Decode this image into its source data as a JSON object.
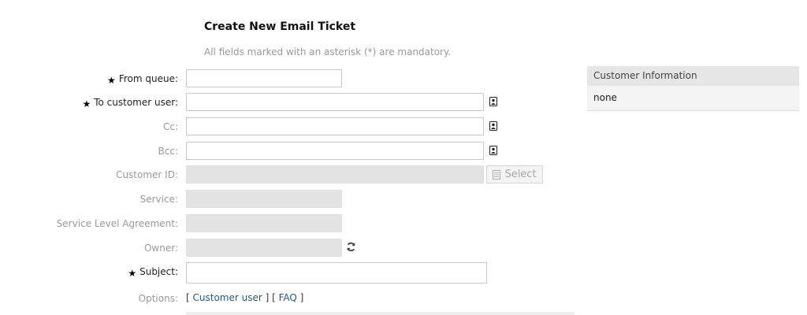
{
  "page": {
    "title": "Create New Email Ticket",
    "hint": "All fields marked with an asterisk (*) are mandatory."
  },
  "form": {
    "fields": [
      {
        "key": "from_queue",
        "label": "From queue:",
        "required": true,
        "value": "",
        "disabled": false
      },
      {
        "key": "to_customer_user",
        "label": "To customer user:",
        "required": true,
        "value": "",
        "disabled": false
      },
      {
        "key": "cc",
        "label": "Cc:",
        "required": false,
        "value": "",
        "disabled": false
      },
      {
        "key": "bcc",
        "label": "Bcc:",
        "required": false,
        "value": "",
        "disabled": false
      },
      {
        "key": "customer_id",
        "label": "Customer ID:",
        "required": false,
        "value": "",
        "disabled": true
      },
      {
        "key": "service",
        "label": "Service:",
        "required": false,
        "value": "",
        "disabled": true
      },
      {
        "key": "sla",
        "label": "Service Level Agreement:",
        "required": false,
        "value": "",
        "disabled": true
      },
      {
        "key": "owner",
        "label": "Owner:",
        "required": false,
        "value": "",
        "disabled": true
      },
      {
        "key": "subject",
        "label": "Subject:",
        "required": true,
        "value": "",
        "disabled": false
      }
    ],
    "required_marker": "★",
    "customer_select_label": "Select",
    "options_label": "Options:",
    "options_links": {
      "open1": "[ ",
      "customer_user": "Customer user",
      "sep": " ] [ ",
      "faq": "FAQ",
      "close": " ]"
    }
  },
  "sidebar": {
    "customer_info_title": "Customer Information",
    "customer_info_value": "none"
  },
  "icons": {
    "address_book": "address-book-icon",
    "refresh": "refresh-icon",
    "select": "list-icon"
  }
}
